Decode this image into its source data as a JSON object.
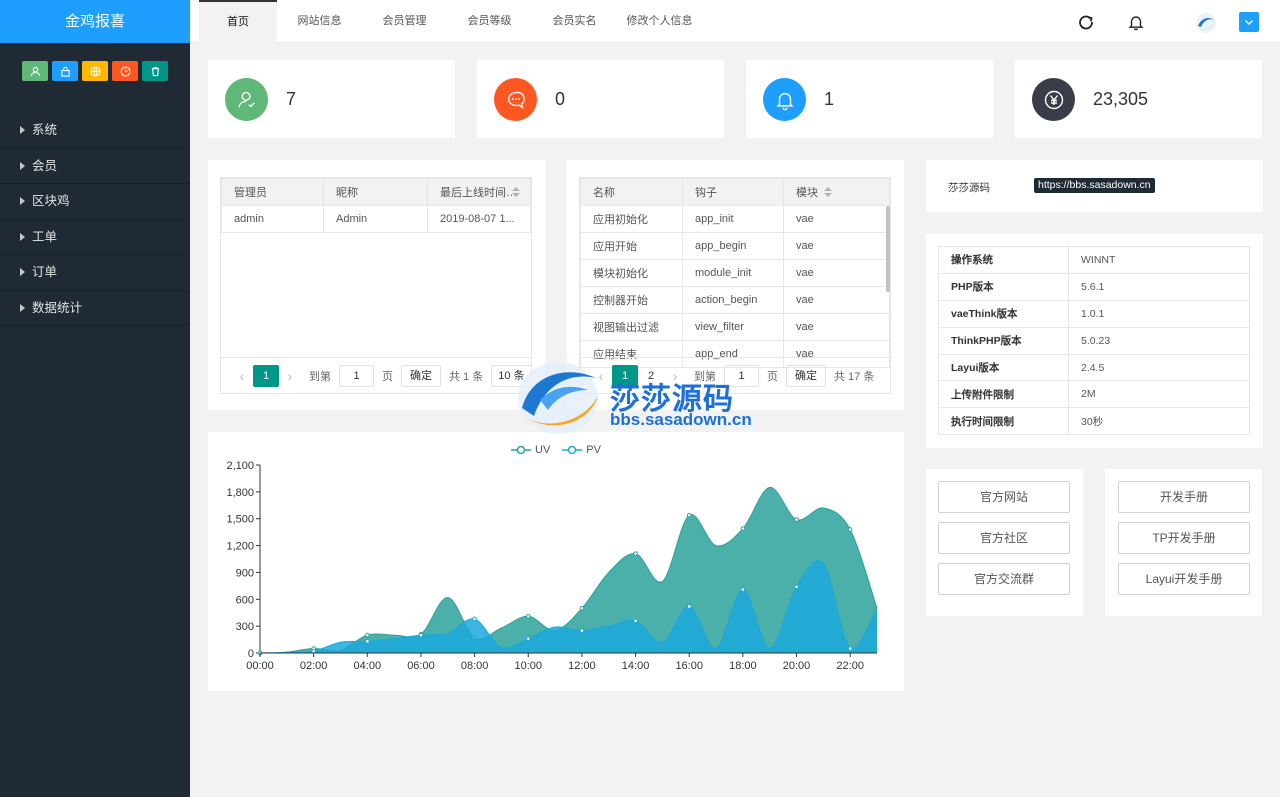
{
  "sidebar": {
    "logo": "金鸡报喜",
    "quick_colors": [
      "#5fb878",
      "#1e9fff",
      "#ffb800",
      "#ff5722",
      "#009688"
    ],
    "nav": [
      {
        "label": "系统"
      },
      {
        "label": "会员"
      },
      {
        "label": "区块鸡"
      },
      {
        "label": "工单"
      },
      {
        "label": "订单"
      },
      {
        "label": "数据统计"
      }
    ]
  },
  "header": {
    "tabs": [
      {
        "label": "首页",
        "active": true
      },
      {
        "label": "网站信息"
      },
      {
        "label": "会员管理"
      },
      {
        "label": "会员等级"
      },
      {
        "label": "会员实名"
      },
      {
        "label": "修改个人信息"
      }
    ],
    "icons": [
      "refresh-icon",
      "bell-icon"
    ]
  },
  "stats": [
    {
      "value": "7",
      "color": "#5fb878",
      "icon": "user-icon"
    },
    {
      "value": "0",
      "color": "#ff5722",
      "icon": "chat-icon"
    },
    {
      "value": "1",
      "color": "#1e9fff",
      "icon": "bell-icon"
    },
    {
      "value": "23,305",
      "color": "#393d49",
      "icon": "yen-icon"
    }
  ],
  "admins": {
    "columns": [
      "管理员",
      "昵称",
      "最后上线时间"
    ],
    "rows": [
      [
        "admin",
        "Admin",
        "2019-08-07 1..."
      ]
    ],
    "pager": {
      "current": "1",
      "goto_label": "到第",
      "page_value": "1",
      "page_unit": "页",
      "confirm": "确定",
      "total": "共 1 条",
      "per_page": "10 条"
    }
  },
  "hooks": {
    "columns": [
      "名称",
      "钩子",
      "模块"
    ],
    "rows": [
      [
        "应用初始化",
        "app_init",
        "vae"
      ],
      [
        "应用开始",
        "app_begin",
        "vae"
      ],
      [
        "模块初始化",
        "module_init",
        "vae"
      ],
      [
        "控制器开始",
        "action_begin",
        "vae"
      ],
      [
        "视图输出过滤",
        "view_filter",
        "vae"
      ],
      [
        "应用结束",
        "app_end",
        "vae"
      ]
    ],
    "pager": {
      "current": "1",
      "page2": "2",
      "goto_label": "到第",
      "page_value": "1",
      "page_unit": "页",
      "confirm": "确定",
      "total": "共 17 条"
    }
  },
  "source": {
    "label": "莎莎源码",
    "url": "https://bbs.sasadown.cn"
  },
  "sysinfo": [
    [
      "操作系统",
      "WINNT"
    ],
    [
      "PHP版本",
      "5.6.1"
    ],
    [
      "vaeThink版本",
      "1.0.1"
    ],
    [
      "ThinkPHP版本",
      "5.0.23"
    ],
    [
      "Layui版本",
      "2.4.5"
    ],
    [
      "上传附件限制",
      "2M"
    ],
    [
      "执行时间限制",
      "30秒"
    ]
  ],
  "links_left": [
    "官方网站",
    "官方社区",
    "官方交流群"
  ],
  "links_right": [
    "开发手册",
    "TP开发手册",
    "Layui开发手册"
  ],
  "watermark": {
    "title": "莎莎源码",
    "url": "bbs.sasadown.cn"
  },
  "chart_data": {
    "type": "area",
    "x": [
      "00:00",
      "01:00",
      "02:00",
      "03:00",
      "04:00",
      "05:00",
      "06:00",
      "07:00",
      "08:00",
      "09:00",
      "10:00",
      "11:00",
      "12:00",
      "13:00",
      "14:00",
      "15:00",
      "16:00",
      "17:00",
      "18:00",
      "19:00",
      "20:00",
      "21:00",
      "22:00",
      "23:00"
    ],
    "x_tick_labels": [
      "00:00",
      "02:00",
      "04:00",
      "06:00",
      "08:00",
      "10:00",
      "12:00",
      "14:00",
      "16:00",
      "18:00",
      "20:00",
      "22:00"
    ],
    "y_tick_labels": [
      "0",
      "300",
      "600",
      "900",
      "1,200",
      "1,500",
      "1,800",
      "2,100"
    ],
    "ylim": [
      0,
      2100
    ],
    "legend": "top-center",
    "series": [
      {
        "name": "UV",
        "color": "#2ba19b",
        "values": [
          0,
          10,
          50,
          30,
          200,
          200,
          210,
          620,
          170,
          280,
          410,
          250,
          500,
          900,
          1110,
          800,
          1540,
          1200,
          1390,
          1850,
          1490,
          1620,
          1380,
          500
        ]
      },
      {
        "name": "PV",
        "color": "#1ba8dc",
        "values": [
          0,
          5,
          20,
          120,
          130,
          160,
          200,
          220,
          380,
          60,
          160,
          290,
          250,
          300,
          360,
          120,
          520,
          50,
          710,
          50,
          740,
          1000,
          50,
          490
        ]
      }
    ]
  }
}
